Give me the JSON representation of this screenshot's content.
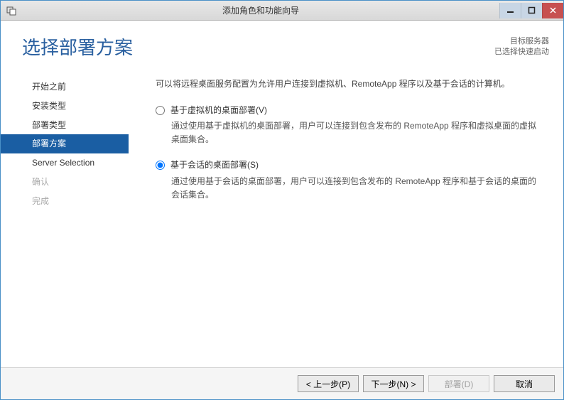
{
  "window": {
    "title": "添加角色和功能向导"
  },
  "header": {
    "page_title": "选择部署方案",
    "server_line1": "目标服务器",
    "server_line2": "已选择快速启动"
  },
  "sidebar": {
    "steps": [
      {
        "label": "开始之前",
        "state": "normal"
      },
      {
        "label": "安装类型",
        "state": "normal"
      },
      {
        "label": "部署类型",
        "state": "normal"
      },
      {
        "label": "部署方案",
        "state": "active"
      },
      {
        "label": "Server Selection",
        "state": "normal"
      },
      {
        "label": "确认",
        "state": "disabled"
      },
      {
        "label": "完成",
        "state": "disabled"
      }
    ]
  },
  "content": {
    "intro": "可以将远程桌面服务配置为允许用户连接到虚拟机、RemoteApp 程序以及基于会话的计算机。",
    "options": [
      {
        "label": "基于虚拟机的桌面部署(V)",
        "desc": "通过使用基于虚拟机的桌面部署，用户可以连接到包含发布的 RemoteApp 程序和虚拟桌面的虚拟桌面集合。",
        "checked": false
      },
      {
        "label": "基于会话的桌面部署(S)",
        "desc": "通过使用基于会话的桌面部署，用户可以连接到包含发布的 RemoteApp 程序和基于会话的桌面的会话集合。",
        "checked": true
      }
    ]
  },
  "footer": {
    "prev": "< 上一步(P)",
    "next": "下一步(N) >",
    "deploy": "部署(D)",
    "cancel": "取消"
  }
}
